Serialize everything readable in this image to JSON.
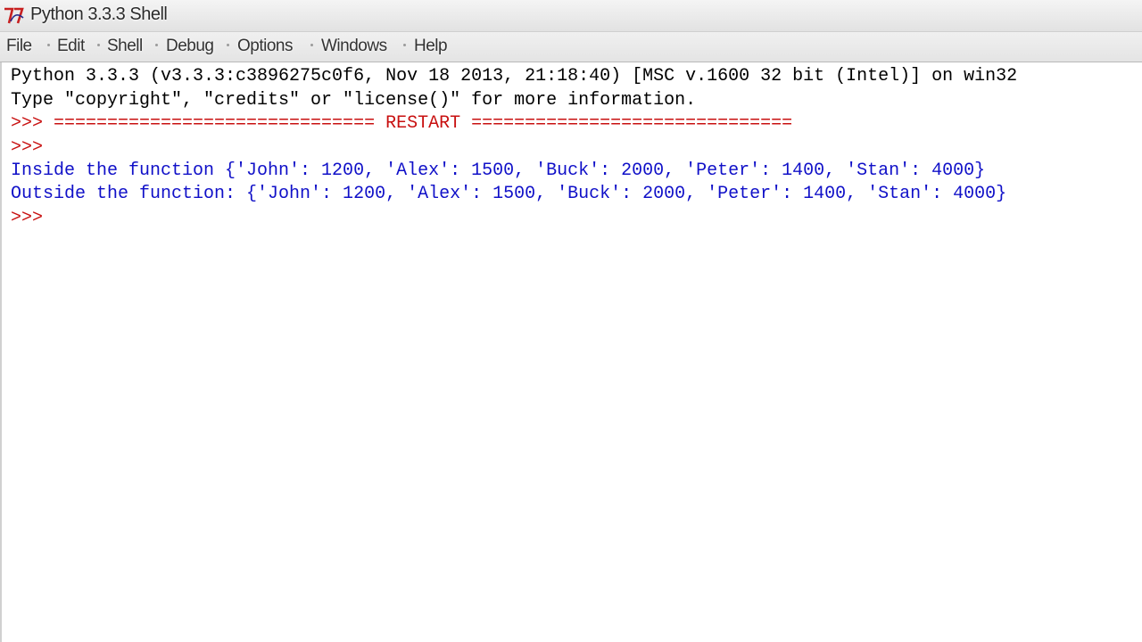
{
  "window": {
    "title": "Python 3.3.3 Shell"
  },
  "menu": {
    "items": [
      "File",
      "Edit",
      "Shell",
      "Debug",
      "Options",
      "Windows",
      "Help"
    ]
  },
  "shell": {
    "banner_line1": "Python 3.3.3 (v3.3.3:c3896275c0f6, Nov 18 2013, 21:18:40) [MSC v.1600 32 bit (Intel)] on win32",
    "banner_line2": "Type \"copyright\", \"credits\" or \"license()\" for more information.",
    "restart_line": ">>> ============================== RESTART ==============================",
    "prompt": ">>>",
    "output_inside": "Inside the function {'John': 1200, 'Alex': 1500, 'Buck': 2000, 'Peter': 1400, 'Stan': 4000}",
    "output_outside": "Outside the function: {'John': 1200, 'Alex': 1500, 'Buck': 2000, 'Peter': 1400, 'Stan': 4000}"
  },
  "colors": {
    "stdout": "#1010c8",
    "prompt": "#c81010",
    "banner": "#000000"
  },
  "icons": {
    "app": "idle-python-icon"
  }
}
